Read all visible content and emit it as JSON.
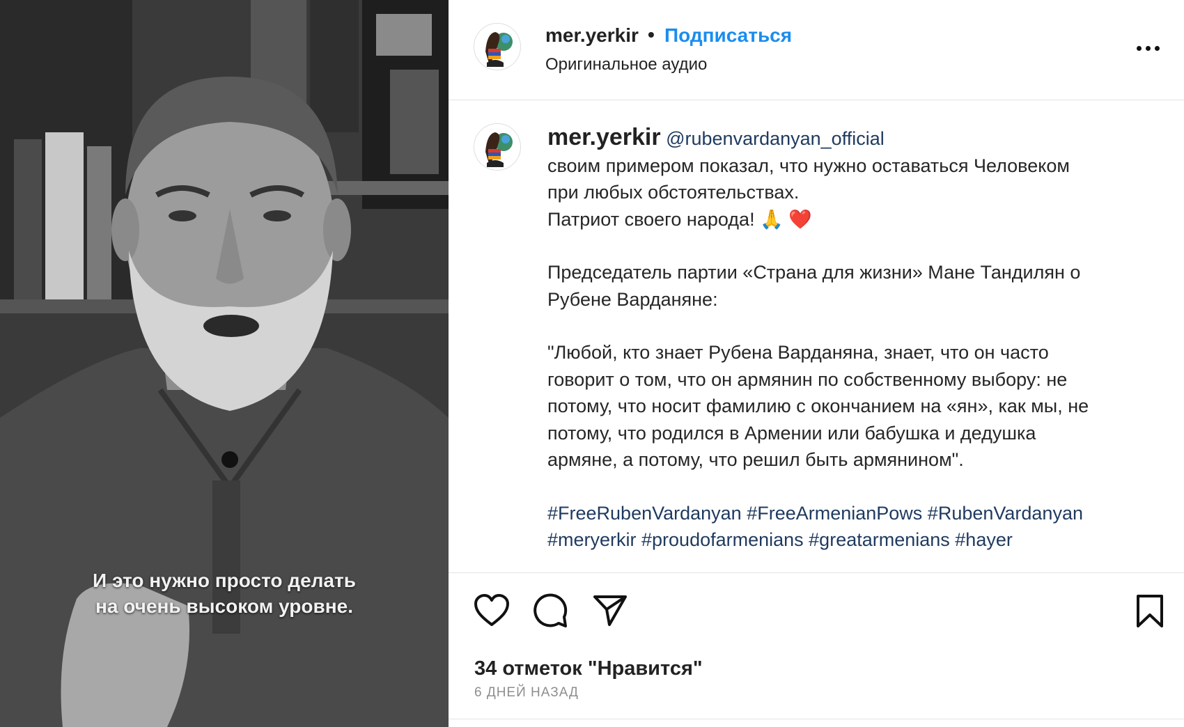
{
  "video": {
    "subtitle_line1": "И это нужно просто делать",
    "subtitle_line2": "на очень высоком уровне."
  },
  "header": {
    "username": "mer.yerkir",
    "separator": "•",
    "follow_label": "Подписаться",
    "audio_label": "Оригинальное аудио",
    "more_icon": "more-horizontal-icon"
  },
  "post": {
    "username": "mer.yerkir",
    "mention": "@rubenvardanyan_official",
    "lines": [
      "своим примером показал, что нужно оставаться Человеком",
      "при любых обстоятельствах.",
      "Патриот своего народа! "
    ],
    "emoji_pray": "🙏",
    "emoji_heart": "❤️",
    "paragraph2": [
      "Председатель партии «Страна для жизни» Мане Тандилян о",
      "Рубене Варданяне:"
    ],
    "paragraph3": [
      "\"Любой, кто знает Рубена Варданяна, знает, что он часто",
      "говорит о том, что он армянин по собственному выбору: не",
      "потому, что носит фамилию с окончанием на «ян», как мы, не",
      "потому, что родился в Армении или бабушка и дедушка",
      "армяне, а потому, что решил быть армянином\"."
    ],
    "hashtags_line1": "#FreeRubenVardanyan #FreeArmenianPows #RubenVardanyan",
    "hashtags_line2": "#meryerkir #proudofarmenians #greatarmenians #hayer"
  },
  "actions": {
    "like_icon": "heart-icon",
    "comment_icon": "comment-icon",
    "share_icon": "send-icon",
    "save_icon": "bookmark-icon"
  },
  "likes_text": "34 отметок \"Нравится\"",
  "date_text": "6 ДНЕЙ НАЗАД",
  "colors": {
    "follow": "#1a8df0",
    "mention": "#1f3a5f",
    "muted": "#8e8e8e"
  }
}
